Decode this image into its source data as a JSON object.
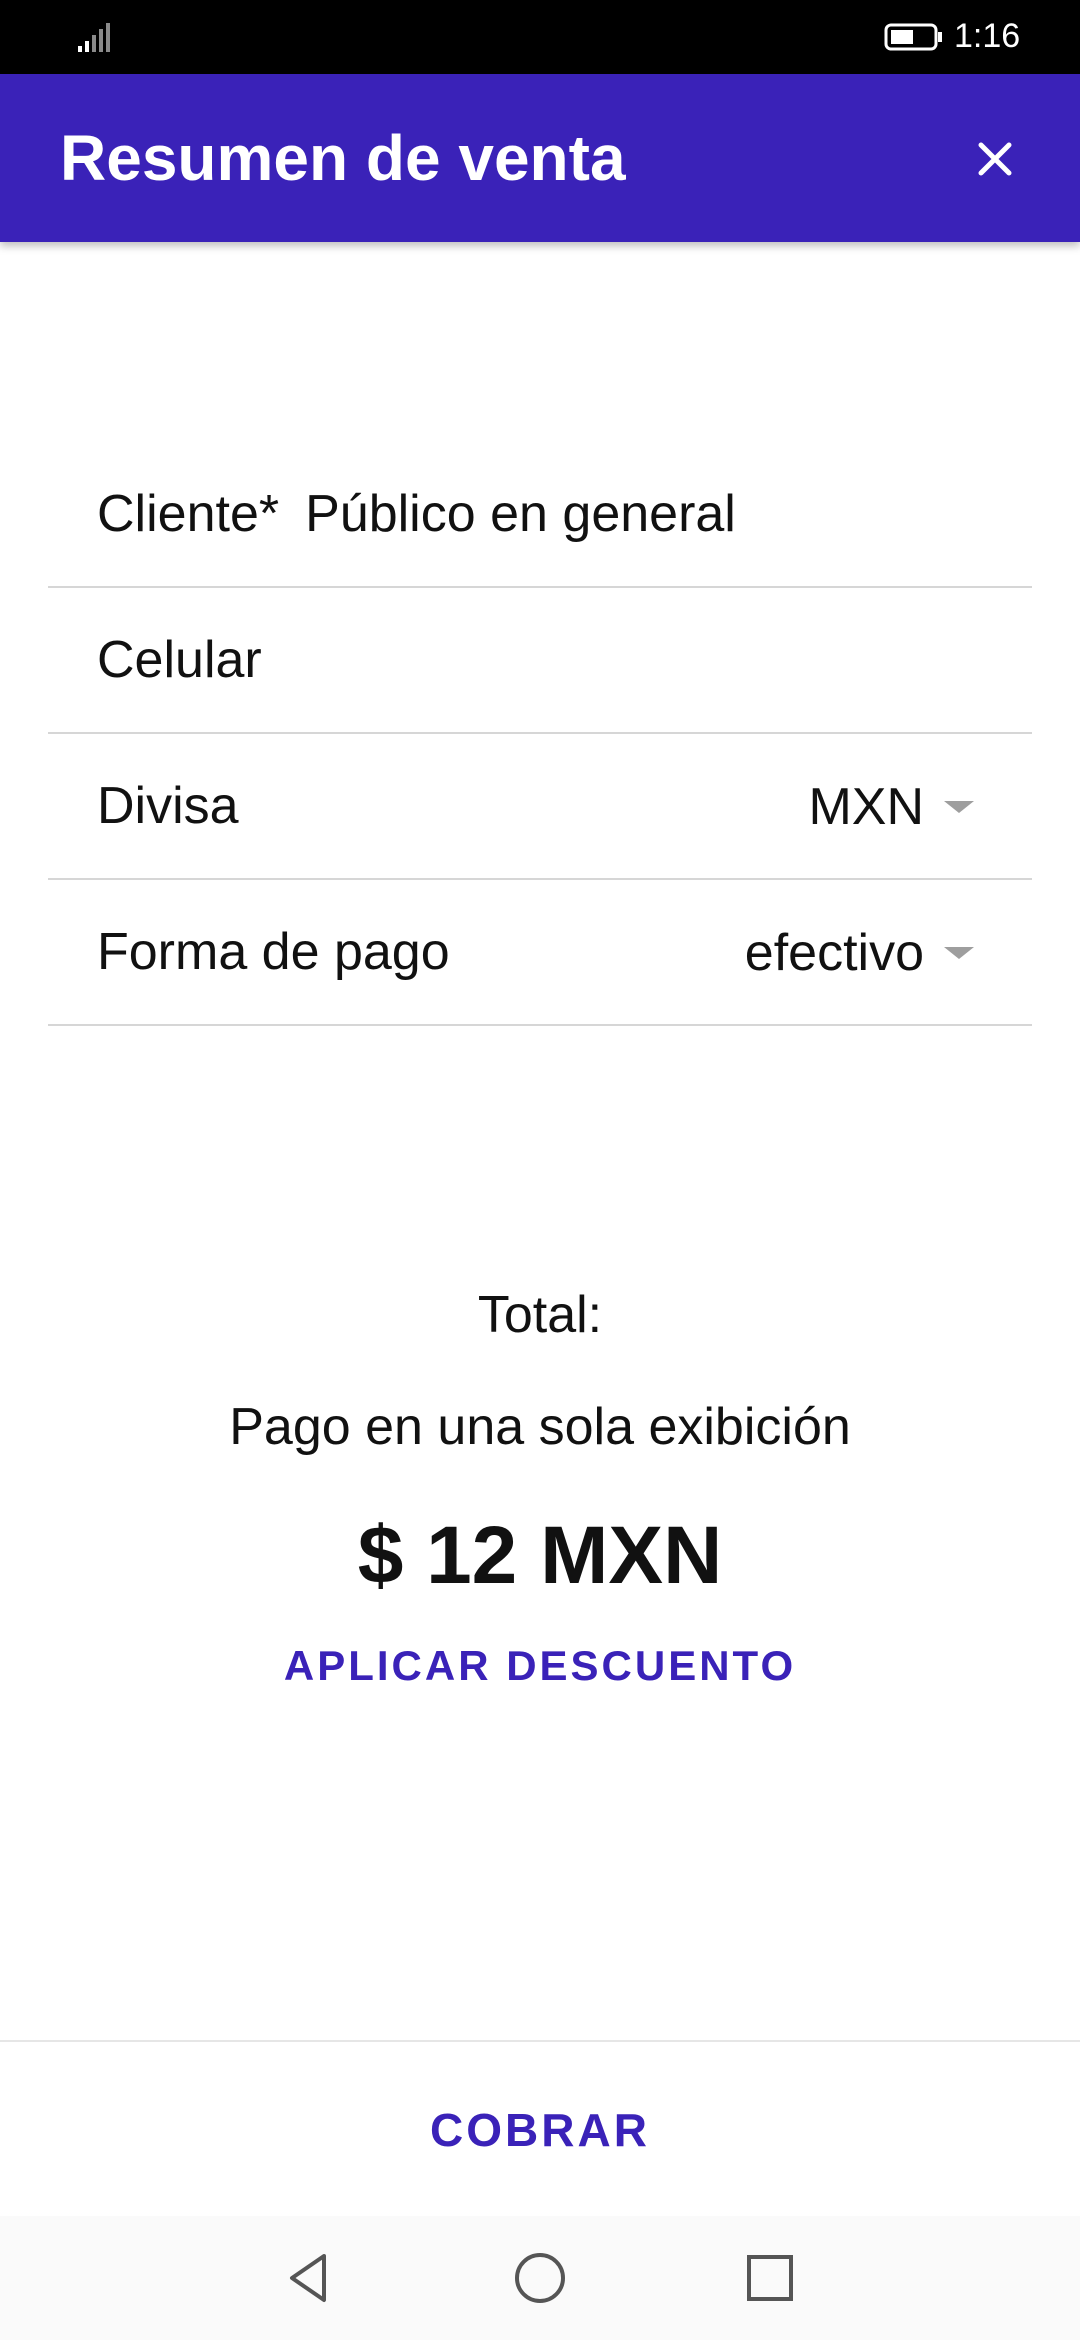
{
  "status_bar": {
    "time": "1:16",
    "icons": [
      "signal-icon",
      "battery-icon"
    ]
  },
  "app_bar": {
    "title": "Resumen de venta",
    "close_icon": "close-icon"
  },
  "form": {
    "cliente": {
      "label": "Cliente*",
      "value": "Público en general"
    },
    "celular": {
      "label": "Celular",
      "value": ""
    },
    "divisa": {
      "label": "Divisa",
      "selected": "MXN"
    },
    "forma_pago": {
      "label": "Forma de pago",
      "selected": "efectivo"
    }
  },
  "total": {
    "label": "Total:",
    "payment_note": "Pago en una sola exibición",
    "amount": "$ 12 MXN",
    "discount_label": "APLICAR DESCUENTO"
  },
  "actions": {
    "charge_label": "COBRAR"
  },
  "nav_bar": {
    "icons": [
      "back-icon",
      "home-icon",
      "recents-icon"
    ]
  },
  "colors": {
    "primary": "#3a22b8",
    "status_bar": "#000000",
    "divider": "#d6d6d6",
    "caret": "#9e9e9e"
  }
}
